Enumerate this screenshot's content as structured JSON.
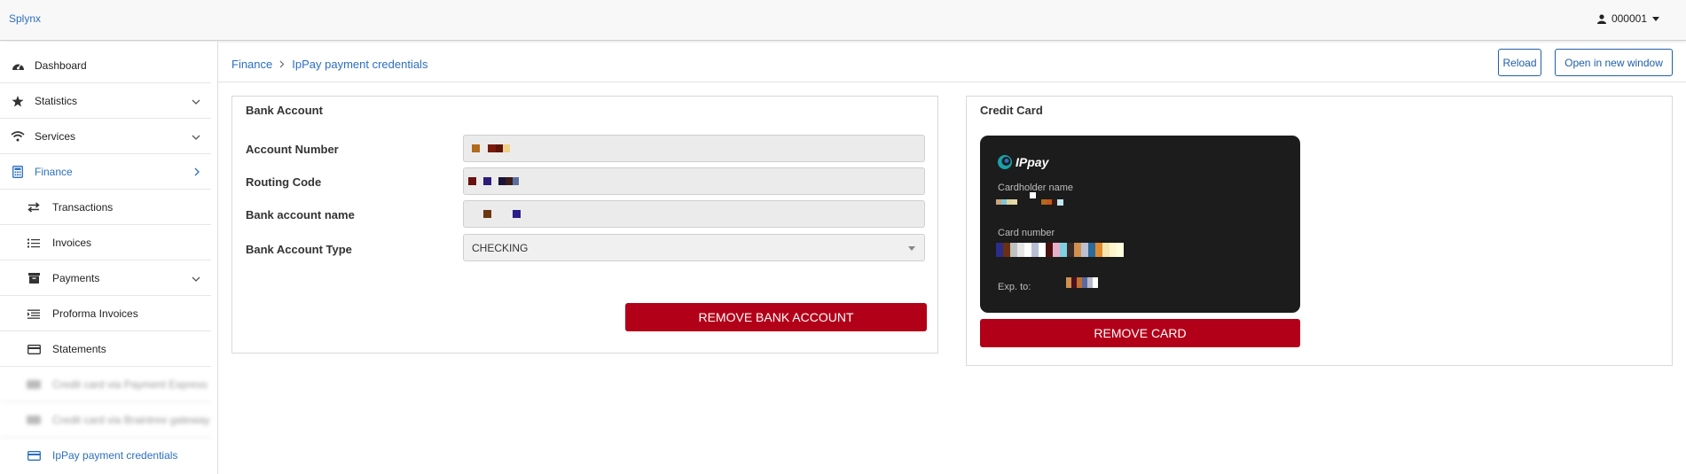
{
  "topbar": {
    "brand": "Splynx",
    "user": "000001"
  },
  "sidebar": {
    "items": [
      {
        "label": "Dashboard",
        "icon": "dashboard-icon"
      },
      {
        "label": "Statistics",
        "icon": "star-icon",
        "expandable": true
      },
      {
        "label": "Services",
        "icon": "wifi-icon",
        "expandable": true
      },
      {
        "label": "Finance",
        "icon": "calculator-icon",
        "active": true
      },
      {
        "label": "Transactions",
        "icon": "transactions-icon"
      },
      {
        "label": "Invoices",
        "icon": "list-icon"
      },
      {
        "label": "Payments",
        "icon": "archive-icon",
        "expandable": true
      },
      {
        "label": "Proforma Invoices",
        "icon": "indent-list-icon"
      },
      {
        "label": "Statements",
        "icon": "card-icon"
      },
      {
        "label": "Credit card via Payment Express",
        "icon": "card-icon",
        "blurred": true
      },
      {
        "label": "Credit card via Braintree gateway",
        "icon": "card-icon",
        "blurred": true
      },
      {
        "label": "IpPay payment credentials",
        "icon": "card-icon",
        "active": true
      }
    ]
  },
  "breadcrumb": {
    "parent": "Finance",
    "current": "IpPay payment credentials"
  },
  "header_buttons": {
    "reload": "Reload",
    "open_window": "Open in new window"
  },
  "bank_account": {
    "title": "Bank Account",
    "fields": [
      {
        "label": "Account Number"
      },
      {
        "label": "Routing Code"
      },
      {
        "label": "Bank account name"
      },
      {
        "label": "Bank Account Type",
        "value": "CHECKING"
      }
    ],
    "remove_button": "REMOVE BANK ACCOUNT"
  },
  "credit_card": {
    "title": "Credit Card",
    "logo_text": "IPpay",
    "cardholder_label": "Cardholder name",
    "number_label": "Card number",
    "exp_label": "Exp. to:",
    "remove_button": "REMOVE CARD"
  },
  "colors": {
    "accent": "#2c6fc1",
    "danger": "#b30019",
    "card_bg": "#1c1c1c"
  }
}
